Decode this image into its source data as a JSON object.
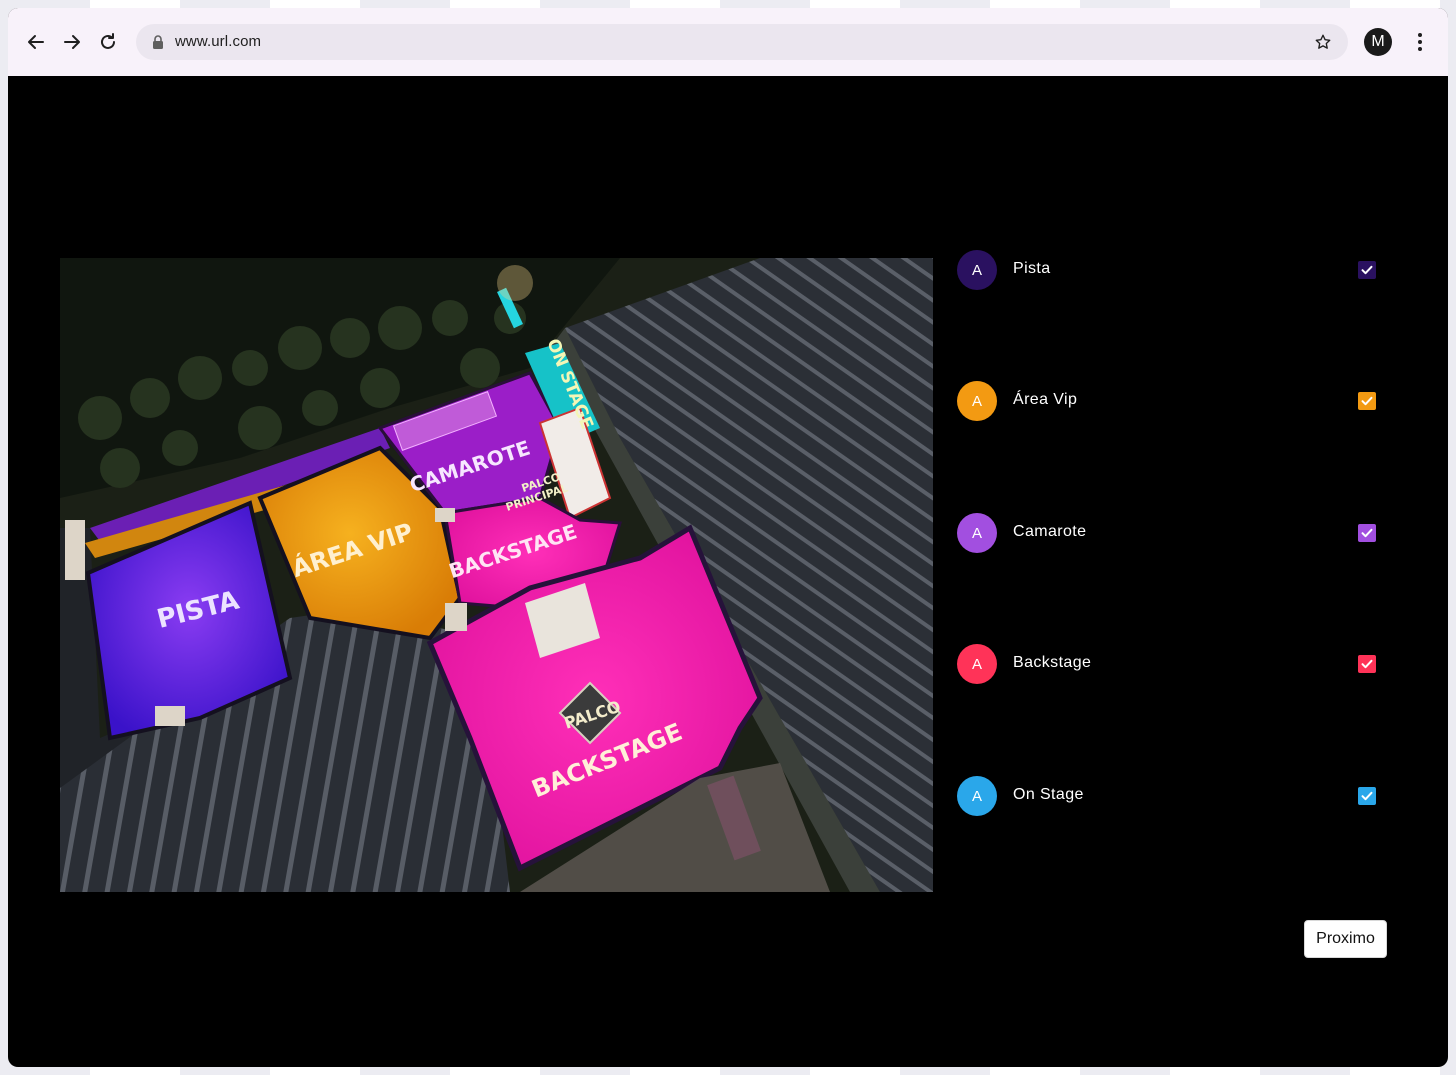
{
  "browser": {
    "url": "www.url.com",
    "profile_initial": "M"
  },
  "map": {
    "labels": {
      "pista": "PISTA",
      "area_vip": "ÁREA VIP",
      "camarote": "CAMAROTE",
      "backstage_upper": "BACKSTAGE",
      "palco_principal_1": "PALCO",
      "palco_principal_2": "PRINCIPAL",
      "on_stage": "ON STAGE",
      "palco": "PALCO",
      "backstage_lower": "BACKSTAGE"
    }
  },
  "legend": {
    "items": [
      {
        "initial": "A",
        "label": "Pista",
        "color": "#2a1160",
        "checked": true
      },
      {
        "initial": "A",
        "label": "Área Vip",
        "color": "#f39a12",
        "checked": true
      },
      {
        "initial": "A",
        "label": "Camarote",
        "color": "#a24fe0",
        "checked": true
      },
      {
        "initial": "A",
        "label": "Backstage",
        "color": "#ff3358",
        "checked": true
      },
      {
        "initial": "A",
        "label": "On Stage",
        "color": "#2aa7ea",
        "checked": true
      }
    ]
  },
  "actions": {
    "next_label": "Proximo"
  }
}
